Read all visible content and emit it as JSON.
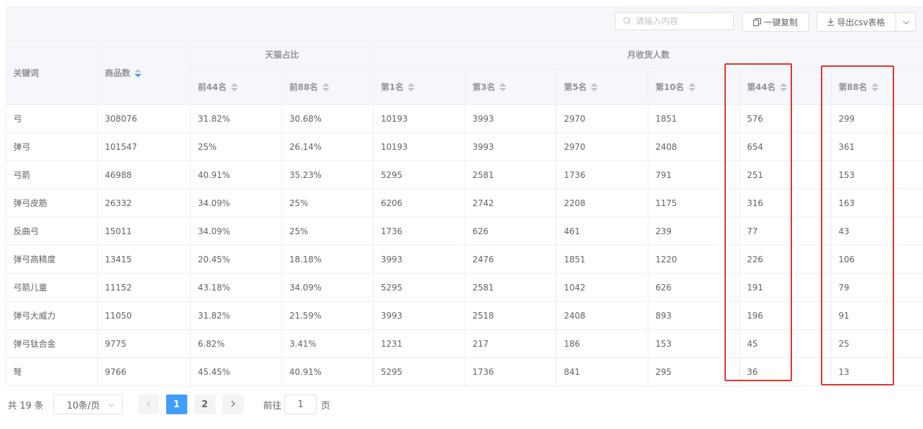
{
  "toolbar": {
    "search_placeholder": "请输入内容",
    "copy_label": "一键复制",
    "export_label": "导出csv表格"
  },
  "table": {
    "headers": {
      "keyword": "关键词",
      "product_count": "商品数",
      "group_tmall": "天猫占比",
      "group_monthly": "月收货人数",
      "top44": "前44名",
      "top88": "前88名",
      "rank1": "第1名",
      "rank3": "第3名",
      "rank5": "第5名",
      "rank10": "第10名",
      "rank44": "第44名",
      "rank88": "第88名"
    },
    "rows": [
      [
        "弓",
        "308076",
        "31.82%",
        "30.68%",
        "10193",
        "3993",
        "2970",
        "1851",
        "576",
        "299"
      ],
      [
        "弹弓",
        "101547",
        "25%",
        "26.14%",
        "10193",
        "3993",
        "2970",
        "2408",
        "654",
        "361"
      ],
      [
        "弓箭",
        "46988",
        "40.91%",
        "35.23%",
        "5295",
        "2581",
        "1736",
        "791",
        "251",
        "153"
      ],
      [
        "弹弓皮筋",
        "26332",
        "34.09%",
        "25%",
        "6206",
        "2742",
        "2208",
        "1175",
        "316",
        "163"
      ],
      [
        "反曲弓",
        "15011",
        "34.09%",
        "25%",
        "1736",
        "626",
        "461",
        "239",
        "77",
        "43"
      ],
      [
        "弹弓高精度",
        "13415",
        "20.45%",
        "18.18%",
        "3993",
        "2476",
        "1851",
        "1220",
        "226",
        "106"
      ],
      [
        "弓箭儿童",
        "11152",
        "43.18%",
        "34.09%",
        "5295",
        "2581",
        "1042",
        "626",
        "191",
        "79"
      ],
      [
        "弹弓大威力",
        "11050",
        "31.82%",
        "21.59%",
        "3993",
        "2518",
        "2408",
        "893",
        "196",
        "91"
      ],
      [
        "弹弓钛合金",
        "9775",
        "6.82%",
        "3.41%",
        "1231",
        "217",
        "186",
        "153",
        "45",
        "25"
      ],
      [
        "弩",
        "9766",
        "45.45%",
        "40.91%",
        "5295",
        "1736",
        "841",
        "295",
        "36",
        "13"
      ]
    ]
  },
  "pagination": {
    "total": "共 19 条",
    "page_size": "10条/页",
    "pages": [
      "1",
      "2"
    ],
    "current_page": "1",
    "jump_prefix": "前往",
    "jump_value": "1",
    "jump_suffix": "页"
  },
  "colors": {
    "accent": "#409eff",
    "highlight": "#e5322d",
    "header_bg": "#f5f7fa"
  }
}
